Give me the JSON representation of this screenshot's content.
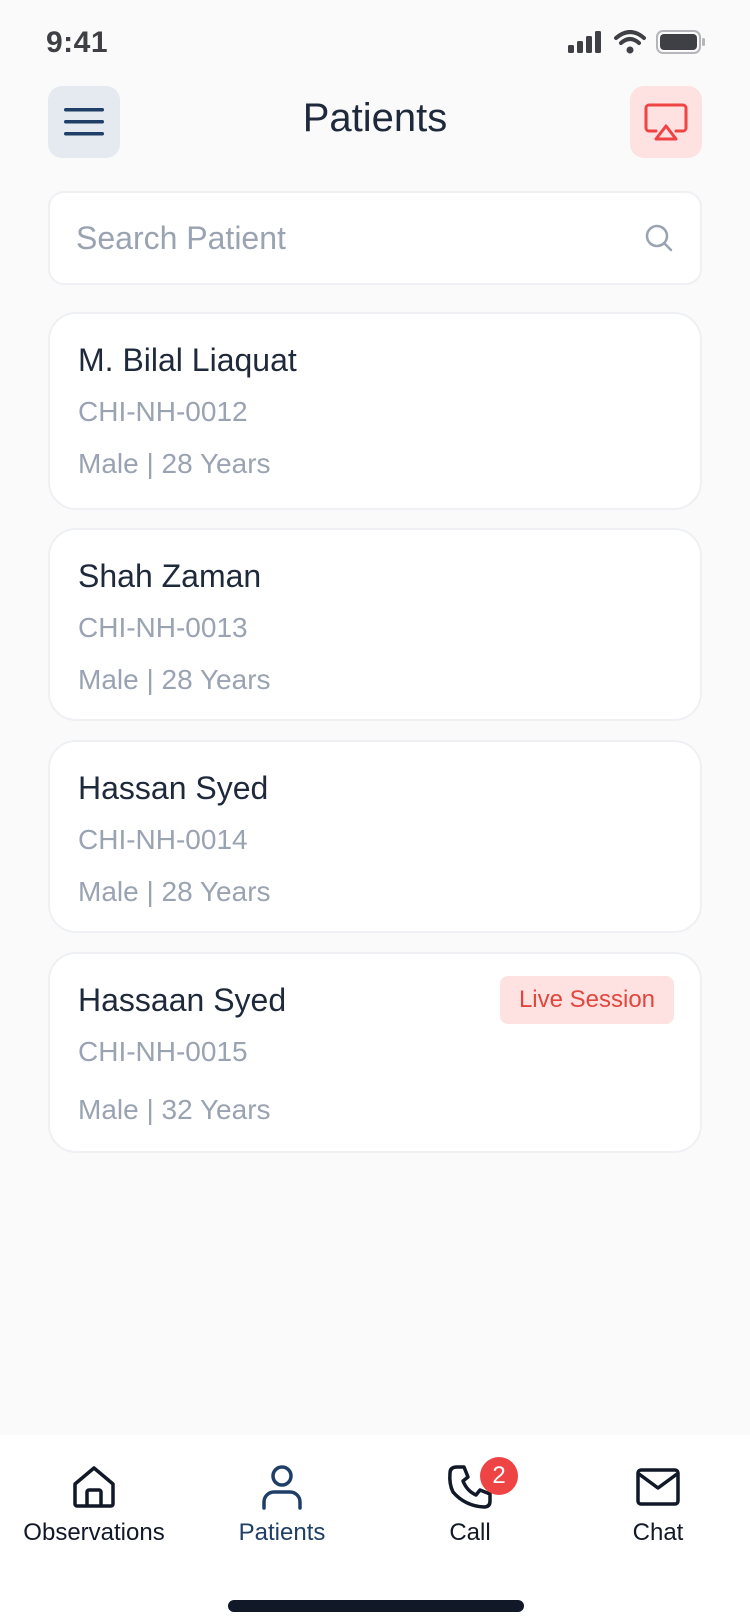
{
  "status_bar": {
    "time": "9:41"
  },
  "header": {
    "title": "Patients"
  },
  "search": {
    "placeholder": "Search Patient",
    "value": ""
  },
  "patients": [
    {
      "name": "M. Bilal Liaquat",
      "id": "CHI-NH-0012",
      "meta": "Male | 28 Years"
    },
    {
      "name": "Shah Zaman",
      "id": "CHI-NH-0013",
      "meta": "Male | 28 Years"
    },
    {
      "name": "Hassan Syed",
      "id": "CHI-NH-0014",
      "meta": "Male | 28 Years"
    },
    {
      "name": "Hassaan Syed",
      "id": "CHI-NH-0015",
      "meta": "Male | 32 Years",
      "badge": "Live Session"
    }
  ],
  "tabbar": {
    "tabs": [
      {
        "label": "Observations",
        "icon": "home-icon"
      },
      {
        "label": "Patients",
        "icon": "user-icon",
        "active": true
      },
      {
        "label": "Call",
        "icon": "phone-icon",
        "badge": "2"
      },
      {
        "label": "Chat",
        "icon": "mail-icon"
      }
    ]
  },
  "colors": {
    "accent": "#1f3f66",
    "danger": "#ef4444",
    "badge_bg": "#fde2e1",
    "muted_text": "#9aa3b2"
  }
}
